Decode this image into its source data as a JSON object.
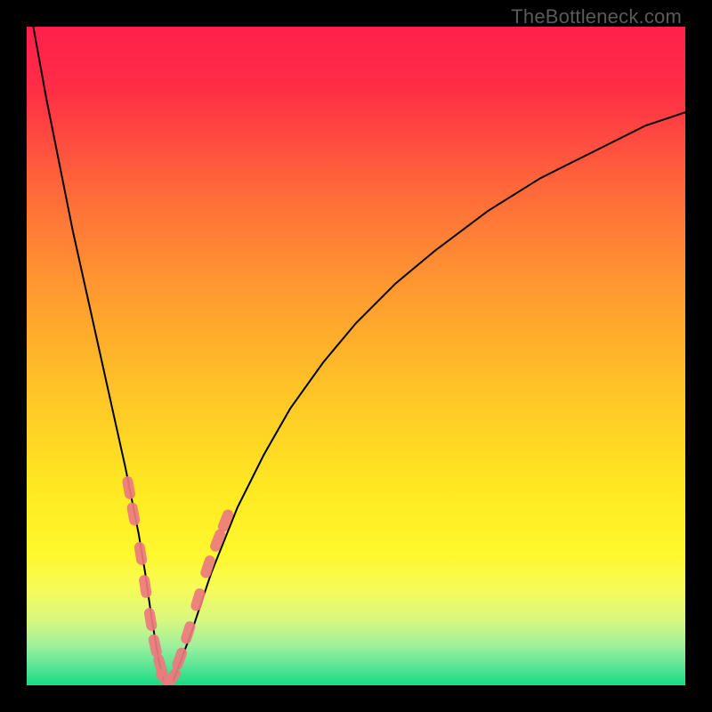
{
  "watermark": "TheBottleneck.com",
  "colors": {
    "gradient_stops": [
      {
        "offset": 0.0,
        "color": "#ff1f4b"
      },
      {
        "offset": 0.1,
        "color": "#ff2f46"
      },
      {
        "offset": 0.25,
        "color": "#ff6a3a"
      },
      {
        "offset": 0.4,
        "color": "#ff9a30"
      },
      {
        "offset": 0.55,
        "color": "#ffc327"
      },
      {
        "offset": 0.7,
        "color": "#ffe822"
      },
      {
        "offset": 0.8,
        "color": "#fff82d"
      },
      {
        "offset": 0.85,
        "color": "#f8fb55"
      },
      {
        "offset": 0.9,
        "color": "#d9f87f"
      },
      {
        "offset": 0.94,
        "color": "#9ef09b"
      },
      {
        "offset": 0.97,
        "color": "#5de596"
      },
      {
        "offset": 1.0,
        "color": "#17db82"
      }
    ],
    "curve_stroke": "#000000",
    "marker_fill": "#ed7a7e",
    "marker_stroke": "#ed7a7e"
  },
  "chart_data": {
    "type": "line",
    "title": "",
    "xlabel": "",
    "ylabel": "",
    "xlim": [
      0,
      100
    ],
    "ylim": [
      0,
      100
    ],
    "grid": false,
    "series": [
      {
        "name": "curve",
        "x": [
          1,
          3,
          5,
          7,
          9,
          11,
          13,
          15,
          17,
          18,
          19,
          20,
          21,
          22,
          25,
          28,
          32,
          36,
          40,
          45,
          50,
          56,
          62,
          70,
          78,
          86,
          94,
          100
        ],
        "y": [
          100,
          89,
          79,
          69,
          60,
          51,
          42,
          33,
          23,
          17,
          10,
          4,
          0,
          0,
          8,
          17,
          27,
          35,
          42,
          49,
          55,
          61,
          66,
          72,
          77,
          81,
          85,
          87
        ]
      }
    ],
    "markers": {
      "name": "highlight-points",
      "comment": "Pink capsule markers clustered near the V-trough of the curve",
      "points": [
        {
          "x": 15.5,
          "y": 30
        },
        {
          "x": 16.2,
          "y": 26
        },
        {
          "x": 17.3,
          "y": 20
        },
        {
          "x": 18.0,
          "y": 15
        },
        {
          "x": 18.8,
          "y": 10
        },
        {
          "x": 19.5,
          "y": 6
        },
        {
          "x": 20.3,
          "y": 3
        },
        {
          "x": 21.0,
          "y": 1
        },
        {
          "x": 22.0,
          "y": 1
        },
        {
          "x": 23.2,
          "y": 4
        },
        {
          "x": 24.5,
          "y": 8
        },
        {
          "x": 26.0,
          "y": 13
        },
        {
          "x": 27.5,
          "y": 18
        },
        {
          "x": 29.0,
          "y": 22
        },
        {
          "x": 30.2,
          "y": 25
        }
      ]
    }
  }
}
